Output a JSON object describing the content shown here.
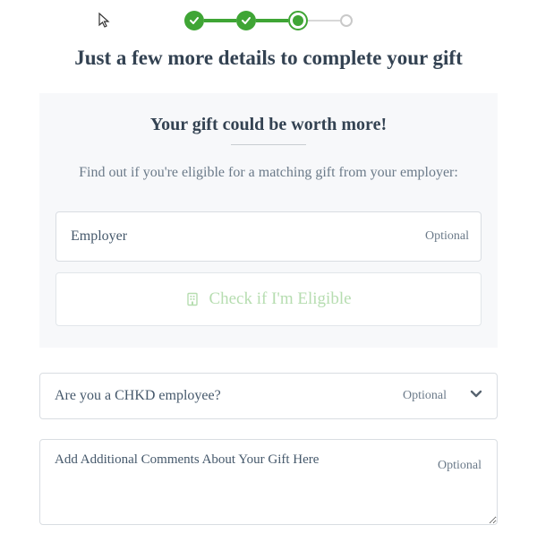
{
  "progress": {
    "steps_total": 4,
    "current_step": 3
  },
  "title": "Just a few more details to complete your gift",
  "panel": {
    "heading": "Your gift could be worth more!",
    "subheading": "Find out if you're eligible for a matching gift from your employer:",
    "employer": {
      "placeholder": "Employer",
      "value": "",
      "optional_label": "Optional"
    },
    "eligibility_button": "Check if I'm Eligible"
  },
  "employee_question": {
    "label": "Are you a CHKD employee?",
    "optional_label": "Optional",
    "value": ""
  },
  "comments": {
    "placeholder": "Add Additional Comments About Your Gift Here",
    "optional_label": "Optional",
    "value": ""
  }
}
